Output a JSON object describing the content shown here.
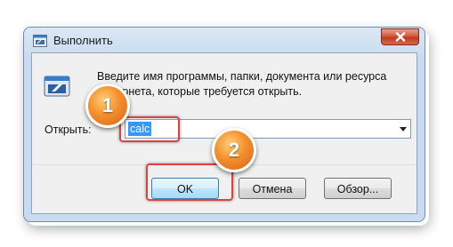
{
  "window": {
    "title": "Выполнить",
    "icon": "run-icon",
    "close_icon": "close-icon"
  },
  "dialog": {
    "description": "Введите имя программы, папки, документа или ресурса Интернета, которые требуется открыть.",
    "open_label": "Открыть:",
    "open_value": "calc"
  },
  "buttons": {
    "ok": "OK",
    "cancel": "Отмена",
    "browse": "Обзор..."
  },
  "annotations": {
    "step1": "1",
    "step2": "2",
    "highlight_color": "#e04040",
    "badge_color": "#f4902c"
  }
}
